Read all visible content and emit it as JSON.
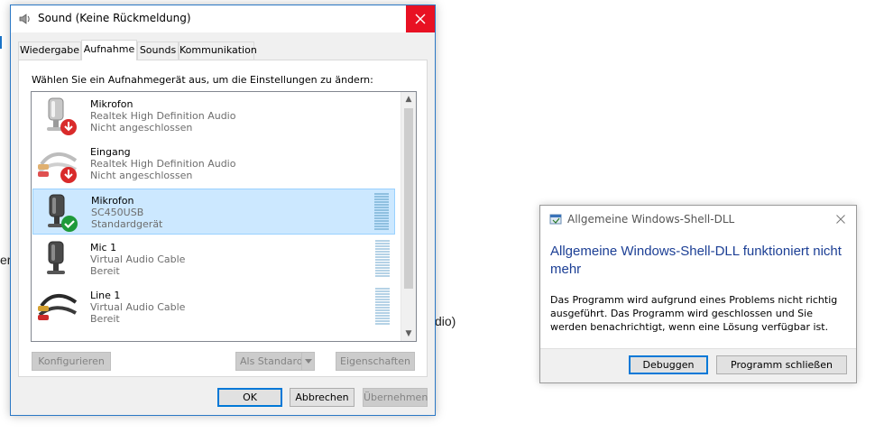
{
  "background": {
    "fragments": [
      "er",
      "dio)"
    ],
    "link_color": "#1a73c8"
  },
  "sound_dialog": {
    "title": "Sound (Keine Rückmeldung)",
    "tabs": [
      {
        "label": "Wiedergabe",
        "active": false
      },
      {
        "label": "Aufnahme",
        "active": true
      },
      {
        "label": "Sounds",
        "active": false
      },
      {
        "label": "Kommunikation",
        "active": false
      }
    ],
    "instruction": "Wählen Sie ein Aufnahmegerät aus, um die Einstellungen zu ändern:",
    "devices": [
      {
        "name": "Mikrofon",
        "driver": "Realtek High Definition Audio",
        "status": "Nicht angeschlossen",
        "icon": "microphone-icon",
        "badge": "disconnected-arrow-icon",
        "selected": false
      },
      {
        "name": "Eingang",
        "driver": "Realtek High Definition Audio",
        "status": "Nicht angeschlossen",
        "icon": "rca-cable-icon",
        "badge": "disconnected-arrow-icon",
        "selected": false
      },
      {
        "name": "Mikrofon",
        "driver": "SC450USB",
        "status": "Standardgerät",
        "icon": "microphone-icon",
        "badge": "default-check-icon",
        "selected": true
      },
      {
        "name": "Mic 1",
        "driver": "Virtual Audio Cable",
        "status": "Bereit",
        "icon": "microphone-icon",
        "badge": "",
        "selected": false
      },
      {
        "name": "Line 1",
        "driver": "Virtual Audio Cable",
        "status": "Bereit",
        "icon": "rca-cable-icon",
        "badge": "",
        "selected": false
      }
    ],
    "buttons": {
      "configure": "Konfigurieren",
      "set_default": "Als Standard",
      "properties": "Eigenschaften",
      "ok": "OK",
      "cancel": "Abbrechen",
      "apply": "Übernehmen"
    },
    "colors": {
      "close": "#e81123",
      "selection": "#cce8ff",
      "disconnected": "#d92b2b",
      "default": "#1e9a3a"
    }
  },
  "error_dialog": {
    "title": "Allgemeine Windows-Shell-DLL",
    "heading": "Allgemeine Windows-Shell-DLL funktioniert nicht mehr",
    "body": "Das Programm wird aufgrund eines Problems nicht richtig ausgeführt. Das Programm wird geschlossen und Sie werden benachrichtigt, wenn eine Lösung verfügbar ist.",
    "buttons": {
      "debug": "Debuggen",
      "close_program": "Programm schließen"
    },
    "colors": {
      "heading": "#1c3f95"
    }
  }
}
